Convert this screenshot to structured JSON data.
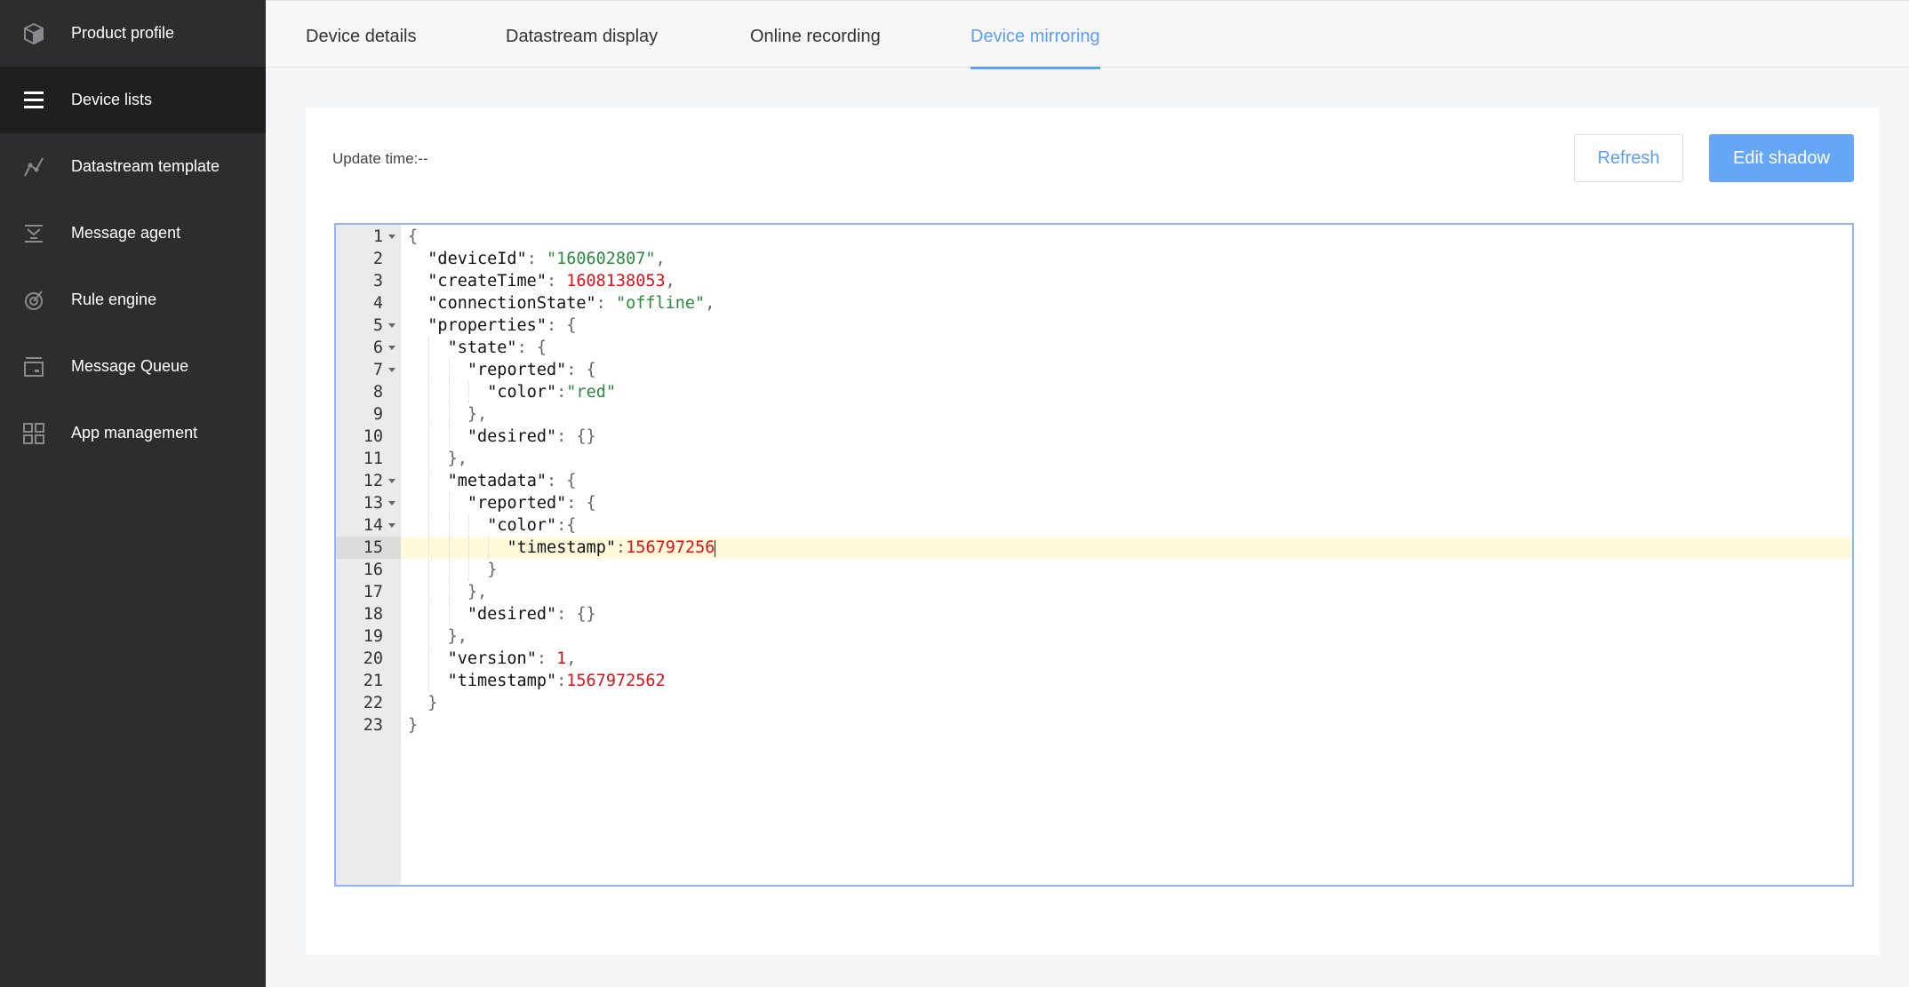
{
  "sidebar": {
    "items": [
      {
        "label": "Product profile",
        "icon": "cube-icon"
      },
      {
        "label": "Device lists",
        "icon": "list-icon",
        "active": true
      },
      {
        "label": "Datastream template",
        "icon": "curve-icon"
      },
      {
        "label": "Message agent",
        "icon": "agent-icon"
      },
      {
        "label": "Rule engine",
        "icon": "target-icon"
      },
      {
        "label": "Message Queue",
        "icon": "queue-icon"
      },
      {
        "label": "App management",
        "icon": "grid-icon"
      }
    ]
  },
  "tabs": [
    {
      "label": "Device details"
    },
    {
      "label": "Datastream display"
    },
    {
      "label": "Online recording"
    },
    {
      "label": "Device mirroring",
      "active": true
    }
  ],
  "content": {
    "update_time": "Update time:--",
    "refresh_label": "Refresh",
    "edit_label": "Edit shadow"
  },
  "colors": {
    "accent": "#5b9ef6",
    "sidebar_bg": "#2d2d30",
    "string": "#2b8a3e",
    "number": "#e0101b"
  },
  "editor": {
    "current_line": 15,
    "lines": [
      {
        "n": "1",
        "fold": true,
        "indent": 0,
        "tokens": [
          [
            "p",
            "{"
          ]
        ]
      },
      {
        "n": "2",
        "indent": 1,
        "tokens": [
          [
            "k",
            "\"deviceId\""
          ],
          [
            "p",
            ": "
          ],
          [
            "s",
            "\"160602807\""
          ],
          [
            "p",
            ","
          ]
        ]
      },
      {
        "n": "3",
        "indent": 1,
        "tokens": [
          [
            "k",
            "\"createTime\""
          ],
          [
            "p",
            ": "
          ],
          [
            "n",
            "1608138053"
          ],
          [
            "p",
            ","
          ]
        ]
      },
      {
        "n": "4",
        "indent": 1,
        "tokens": [
          [
            "k",
            "\"connectionState\""
          ],
          [
            "p",
            ": "
          ],
          [
            "s",
            "\"offline\""
          ],
          [
            "p",
            ","
          ]
        ]
      },
      {
        "n": "5",
        "fold": true,
        "indent": 1,
        "tokens": [
          [
            "k",
            "\"properties\""
          ],
          [
            "p",
            ": {"
          ]
        ]
      },
      {
        "n": "6",
        "fold": true,
        "indent": 2,
        "tokens": [
          [
            "k",
            "\"state\""
          ],
          [
            "p",
            ": {"
          ]
        ]
      },
      {
        "n": "7",
        "fold": true,
        "indent": 3,
        "tokens": [
          [
            "k",
            "\"reported\""
          ],
          [
            "p",
            ": {"
          ]
        ]
      },
      {
        "n": "8",
        "indent": 4,
        "tokens": [
          [
            "k",
            "\"color\""
          ],
          [
            "p",
            ":"
          ],
          [
            "s",
            "\"red\""
          ]
        ]
      },
      {
        "n": "9",
        "indent": 3,
        "tokens": [
          [
            "p",
            "},"
          ]
        ]
      },
      {
        "n": "10",
        "indent": 3,
        "tokens": [
          [
            "k",
            "\"desired\""
          ],
          [
            "p",
            ": {}"
          ]
        ]
      },
      {
        "n": "11",
        "indent": 2,
        "tokens": [
          [
            "p",
            "},"
          ]
        ]
      },
      {
        "n": "12",
        "fold": true,
        "indent": 2,
        "tokens": [
          [
            "k",
            "\"metadata\""
          ],
          [
            "p",
            ": {"
          ]
        ]
      },
      {
        "n": "13",
        "fold": true,
        "indent": 3,
        "tokens": [
          [
            "k",
            "\"reported\""
          ],
          [
            "p",
            ": {"
          ]
        ]
      },
      {
        "n": "14",
        "fold": true,
        "indent": 4,
        "tokens": [
          [
            "k",
            "\"color\""
          ],
          [
            "p",
            ":{"
          ]
        ]
      },
      {
        "n": "15",
        "indent": 5,
        "tokens": [
          [
            "k",
            "\"timestamp\""
          ],
          [
            "p",
            ":"
          ],
          [
            "n",
            "156797256"
          ]
        ]
      },
      {
        "n": "16",
        "indent": 4,
        "tokens": [
          [
            "p",
            "}"
          ]
        ]
      },
      {
        "n": "17",
        "indent": 3,
        "tokens": [
          [
            "p",
            "},"
          ]
        ]
      },
      {
        "n": "18",
        "indent": 3,
        "tokens": [
          [
            "k",
            "\"desired\""
          ],
          [
            "p",
            ": {}"
          ]
        ]
      },
      {
        "n": "19",
        "indent": 2,
        "tokens": [
          [
            "p",
            "},"
          ]
        ]
      },
      {
        "n": "20",
        "indent": 2,
        "tokens": [
          [
            "k",
            "\"version\""
          ],
          [
            "p",
            ": "
          ],
          [
            "n",
            "1"
          ],
          [
            "p",
            ","
          ]
        ]
      },
      {
        "n": "21",
        "indent": 2,
        "tokens": [
          [
            "k",
            "\"timestamp\""
          ],
          [
            "p",
            ":"
          ],
          [
            "n",
            "1567972562"
          ]
        ]
      },
      {
        "n": "22",
        "indent": 1,
        "tokens": [
          [
            "p",
            "}"
          ]
        ]
      },
      {
        "n": "23",
        "indent": 0,
        "tokens": [
          [
            "p",
            "}"
          ]
        ]
      }
    ]
  }
}
